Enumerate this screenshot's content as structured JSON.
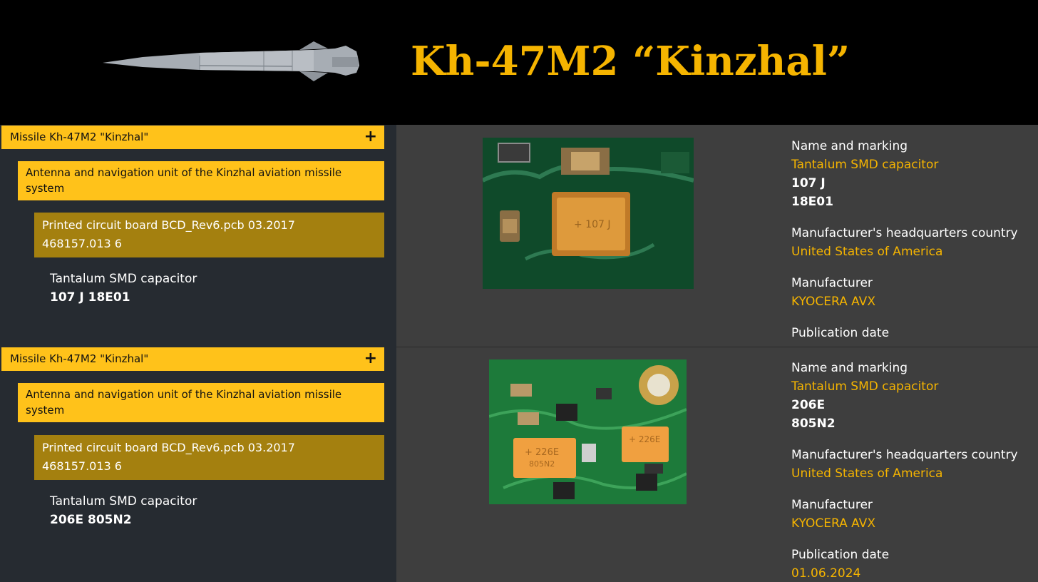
{
  "header": {
    "title": "Kh-47M2 “Kinzhal”"
  },
  "colors": {
    "accent": "#ffc21a",
    "accent_dark": "#a4800f",
    "title": "#f5b400",
    "left_bg": "#262b31",
    "right_bg": "#3e3e3e"
  },
  "entries": [
    {
      "level1": "Missile Kh-47M2 \"Kinzhal\"",
      "level2": "Antenna and navigation unit of the Kinzhal aviation missile system",
      "level3_line1": "Printed circuit board BCD_Rev6.pcb 03.2017",
      "level3_line2": "468157.013 6",
      "component_name": "Tantalum SMD capacitor",
      "component_marking": "107 J 18E01",
      "details": {
        "name_label": "Name and marking",
        "name_value": "Tantalum SMD capacitor",
        "marking_line1": "107 J",
        "marking_line2": "18E01",
        "country_label": "Manufacturer's headquarters country",
        "country_value": "United States of America",
        "manufacturer_label": "Manufacturer",
        "manufacturer_value": "KYOCERA AVX",
        "pubdate_label": "Publication date"
      },
      "expand_icon": "plus-icon"
    },
    {
      "level1": "Missile Kh-47M2 \"Kinzhal\"",
      "level2": "Antenna and navigation unit of the Kinzhal aviation missile system",
      "level3_line1": "Printed circuit board BCD_Rev6.pcb 03.2017",
      "level3_line2": "468157.013 6",
      "component_name": "Tantalum SMD capacitor",
      "component_marking": "206E 805N2",
      "details": {
        "name_label": "Name and marking",
        "name_value": "Tantalum SMD capacitor",
        "marking_line1": "206E",
        "marking_line2": "805N2",
        "country_label": "Manufacturer's headquarters country",
        "country_value": "United States of America",
        "manufacturer_label": "Manufacturer",
        "manufacturer_value": "KYOCERA AVX",
        "pubdate_label": "Publication date",
        "pubdate_value": "01.06.2024"
      },
      "expand_icon": "plus-icon"
    }
  ]
}
